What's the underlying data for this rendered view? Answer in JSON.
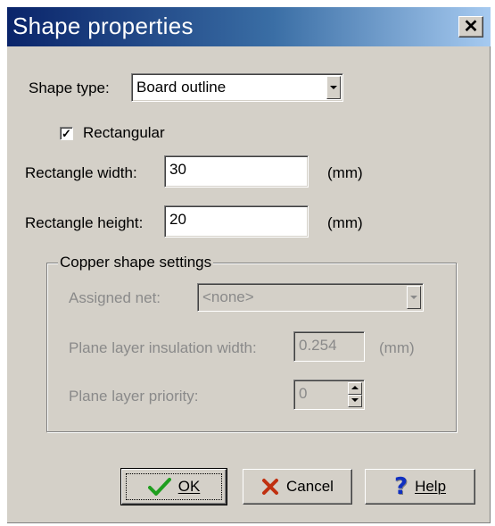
{
  "window": {
    "title": "Shape properties",
    "close_glyph": "✕"
  },
  "form": {
    "shape_type_label": "Shape type:",
    "shape_type_value": "Board outline",
    "rectangular_label": "Rectangular",
    "rectangular_checked": true,
    "rect_width_label": "Rectangle width:",
    "rect_width_value": "30",
    "rect_width_unit": "(mm)",
    "rect_height_label": "Rectangle height:",
    "rect_height_value": "20",
    "rect_height_unit": "(mm)"
  },
  "copper": {
    "group_title": "Copper shape settings",
    "assigned_net_label": "Assigned net:",
    "assigned_net_value": "<none>",
    "insulation_label": "Plane layer insulation width:",
    "insulation_value": "0.254",
    "insulation_unit": "(mm)",
    "priority_label": "Plane layer priority:",
    "priority_value": "0"
  },
  "buttons": {
    "ok_label": "OK",
    "cancel_label": "Cancel",
    "help_label": "Help"
  },
  "icons": {
    "ok": "check-icon",
    "cancel": "x-icon",
    "help": "question-icon",
    "ok_color": "#1f9e1f",
    "cancel_color": "#c03010",
    "help_color": "#1030c0"
  }
}
